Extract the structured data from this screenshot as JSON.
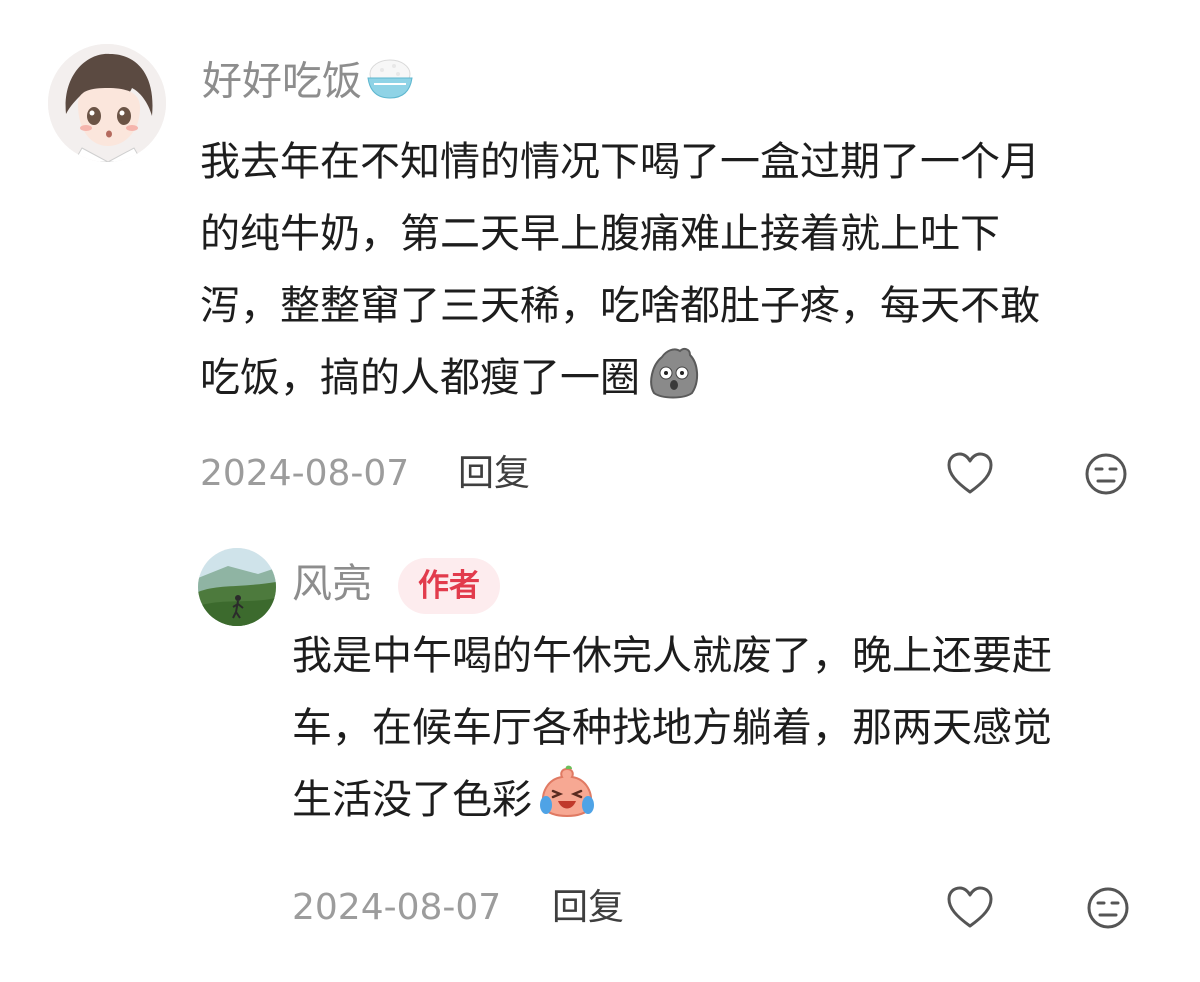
{
  "comments": [
    {
      "username": "好好吃饭",
      "username_emoji": "rice-bowl-icon",
      "text_lines": [
        "我去年在不知情的情况下喝了一盒过期了一个月",
        "的纯牛奶，第二天早上腹痛难止接着就上吐下",
        "泻，整整窜了三天稀，吃啥都肚子疼，每天不敢",
        "吃饭，搞的人都瘦了一圈"
      ],
      "trailing_emoji": "shocked-rock-icon",
      "date": "2024-08-07",
      "reply_label": "回复"
    },
    {
      "username": "风亮",
      "author_badge": "作者",
      "text_lines": [
        "我是中午喝的午休完人就废了，晚上还要赶",
        "车，在候车厅各种找地方躺着，那两天感觉",
        "生活没了色彩"
      ],
      "trailing_emoji": "laughing-crying-peach-icon",
      "date": "2024-08-07",
      "reply_label": "回复"
    }
  ],
  "colors": {
    "username": "#8d8d8d",
    "text": "#1d1d1d",
    "meta": "#9c9c9c",
    "badge_text": "#e23b4c",
    "badge_bg": "#fdecee"
  }
}
